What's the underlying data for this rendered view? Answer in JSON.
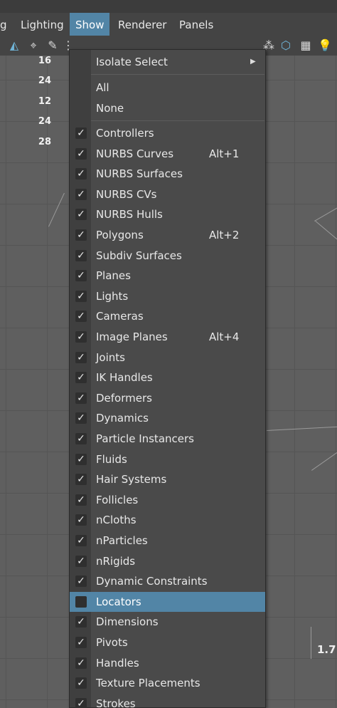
{
  "menubar": {
    "items": [
      {
        "label": "g"
      },
      {
        "label": "Lighting"
      },
      {
        "label": "Show",
        "active": true
      },
      {
        "label": "Renderer"
      },
      {
        "label": "Panels"
      }
    ]
  },
  "hud": {
    "numbers": [
      "16",
      "24",
      "12",
      "24",
      "28"
    ]
  },
  "viewport": {
    "coord_label": "1.7"
  },
  "show_menu": {
    "isolate_select": "Isolate Select",
    "all": "All",
    "none": "None",
    "items": [
      {
        "label": "Controllers",
        "checked": true,
        "shortcut": ""
      },
      {
        "label": "NURBS Curves",
        "checked": true,
        "shortcut": "Alt+1"
      },
      {
        "label": "NURBS Surfaces",
        "checked": true,
        "shortcut": ""
      },
      {
        "label": "NURBS CVs",
        "checked": true,
        "shortcut": ""
      },
      {
        "label": "NURBS Hulls",
        "checked": true,
        "shortcut": ""
      },
      {
        "label": "Polygons",
        "checked": true,
        "shortcut": "Alt+2"
      },
      {
        "label": "Subdiv Surfaces",
        "checked": true,
        "shortcut": ""
      },
      {
        "label": "Planes",
        "checked": true,
        "shortcut": ""
      },
      {
        "label": "Lights",
        "checked": true,
        "shortcut": ""
      },
      {
        "label": "Cameras",
        "checked": true,
        "shortcut": ""
      },
      {
        "label": "Image Planes",
        "checked": true,
        "shortcut": "Alt+4"
      },
      {
        "label": "Joints",
        "checked": true,
        "shortcut": ""
      },
      {
        "label": "IK Handles",
        "checked": true,
        "shortcut": ""
      },
      {
        "label": "Deformers",
        "checked": true,
        "shortcut": ""
      },
      {
        "label": "Dynamics",
        "checked": true,
        "shortcut": ""
      },
      {
        "label": "Particle Instancers",
        "checked": true,
        "shortcut": ""
      },
      {
        "label": "Fluids",
        "checked": true,
        "shortcut": ""
      },
      {
        "label": "Hair Systems",
        "checked": true,
        "shortcut": ""
      },
      {
        "label": "Follicles",
        "checked": true,
        "shortcut": ""
      },
      {
        "label": "nCloths",
        "checked": true,
        "shortcut": ""
      },
      {
        "label": "nParticles",
        "checked": true,
        "shortcut": ""
      },
      {
        "label": "nRigids",
        "checked": true,
        "shortcut": ""
      },
      {
        "label": "Dynamic Constraints",
        "checked": true,
        "shortcut": ""
      },
      {
        "label": "Locators",
        "checked": false,
        "shortcut": "",
        "highlighted": true
      },
      {
        "label": "Dimensions",
        "checked": true,
        "shortcut": ""
      },
      {
        "label": "Pivots",
        "checked": true,
        "shortcut": ""
      },
      {
        "label": "Handles",
        "checked": true,
        "shortcut": ""
      },
      {
        "label": "Texture Placements",
        "checked": true,
        "shortcut": ""
      },
      {
        "label": "Strokes",
        "checked": true,
        "shortcut": ""
      }
    ]
  },
  "colors": {
    "highlight": "#5285a6",
    "menu_bg": "#4a4a4a",
    "menubar_bg": "#444444",
    "viewport_bg": "#5f5f5f"
  }
}
